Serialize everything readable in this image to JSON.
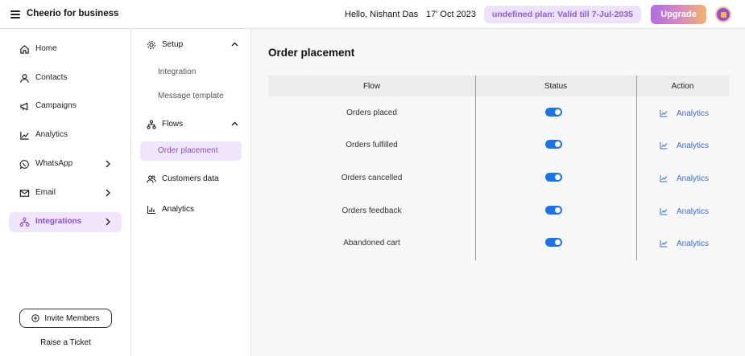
{
  "header": {
    "brand": "Cheerio for business",
    "greeting": "Hello, Nishant Das",
    "date": "17' Oct 2023",
    "plan": "undefined plan: Valid till 7-Jul-2035",
    "upgrade_label": "Upgrade"
  },
  "sidebar": {
    "items": [
      {
        "label": "Home",
        "icon": "home-icon"
      },
      {
        "label": "Contacts",
        "icon": "user-icon"
      },
      {
        "label": "Campaigns",
        "icon": "megaphone-icon"
      },
      {
        "label": "Analytics",
        "icon": "chart-icon"
      },
      {
        "label": "WhatsApp",
        "icon": "whatsapp-icon"
      },
      {
        "label": "Email",
        "icon": "mail-icon"
      },
      {
        "label": "Integrations",
        "icon": "integrations-icon"
      }
    ],
    "invite_label": "Invite Members",
    "raise_ticket_label": "Raise a Ticket"
  },
  "subbar": {
    "setup_label": "Setup",
    "setup_items": [
      "Integration",
      "Message template"
    ],
    "flows_label": "Flows",
    "flows_items": [
      "Order placement"
    ],
    "customers_label": "Customers data",
    "analytics_label": "Analytics"
  },
  "main": {
    "title": "Order placement",
    "columns": [
      "Flow",
      "Status",
      "Action"
    ],
    "rows": [
      {
        "flow": "Orders placed",
        "enabled": true,
        "action": "Analytics"
      },
      {
        "flow": "Orders fulfilled",
        "enabled": true,
        "action": "Analytics"
      },
      {
        "flow": "Orders cancelled",
        "enabled": true,
        "action": "Analytics"
      },
      {
        "flow": "Orders feedback",
        "enabled": true,
        "action": "Analytics"
      },
      {
        "flow": "Abandoned cart",
        "enabled": true,
        "action": "Analytics"
      }
    ]
  },
  "colors": {
    "accent": "#8a4fd6",
    "toggle_on": "#1a73e8",
    "link": "#3b6fd4"
  }
}
